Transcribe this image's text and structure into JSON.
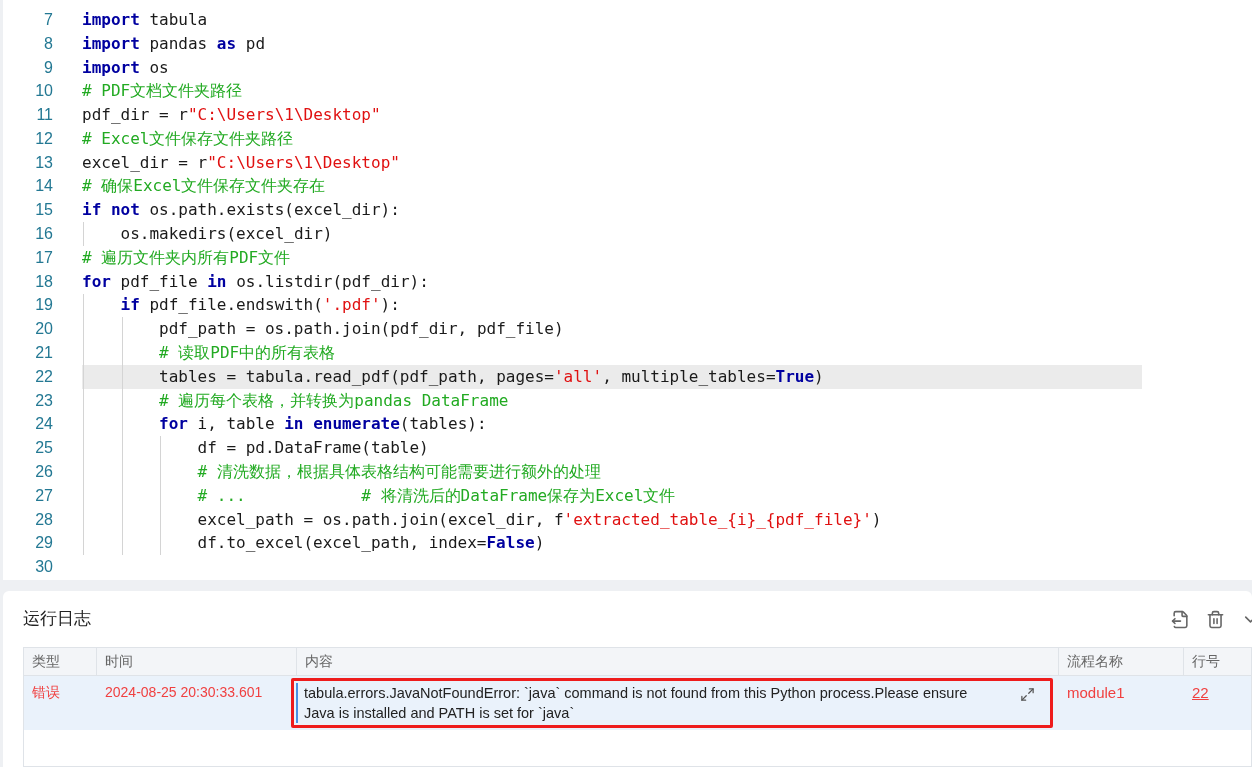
{
  "editor": {
    "lines": [
      {
        "number": "7",
        "highlighted": false,
        "tokens": [
          {
            "kind": "kw",
            "text": "import"
          },
          {
            "kind": "plain",
            "text": " tabula"
          }
        ]
      },
      {
        "number": "8",
        "highlighted": false,
        "tokens": [
          {
            "kind": "kw",
            "text": "import"
          },
          {
            "kind": "plain",
            "text": " pandas "
          },
          {
            "kind": "kw",
            "text": "as"
          },
          {
            "kind": "plain",
            "text": " pd"
          }
        ]
      },
      {
        "number": "9",
        "highlighted": false,
        "tokens": [
          {
            "kind": "kw",
            "text": "import"
          },
          {
            "kind": "plain",
            "text": " os"
          }
        ]
      },
      {
        "number": "10",
        "highlighted": false,
        "tokens": [
          {
            "kind": "comment",
            "text": "# PDF文档文件夹路径"
          }
        ]
      },
      {
        "number": "11",
        "highlighted": false,
        "tokens": [
          {
            "kind": "plain",
            "text": "pdf_dir = r"
          },
          {
            "kind": "str",
            "text": "\"C:\\Users\\1\\Desktop\""
          }
        ]
      },
      {
        "number": "12",
        "highlighted": false,
        "tokens": [
          {
            "kind": "comment",
            "text": "# Excel文件保存文件夹路径"
          }
        ]
      },
      {
        "number": "13",
        "highlighted": false,
        "tokens": [
          {
            "kind": "plain",
            "text": "excel_dir = r"
          },
          {
            "kind": "str",
            "text": "\"C:\\Users\\1\\Desktop\""
          }
        ]
      },
      {
        "number": "14",
        "highlighted": false,
        "tokens": [
          {
            "kind": "comment",
            "text": "# 确保Excel文件保存文件夹存在"
          }
        ]
      },
      {
        "number": "15",
        "highlighted": false,
        "tokens": [
          {
            "kind": "kw",
            "text": "if not"
          },
          {
            "kind": "plain",
            "text": " os.path.exists(excel_dir):"
          }
        ],
        "children": [
          {
            "number": "16",
            "highlighted": false,
            "tokens": [
              {
                "kind": "plain",
                "text": "os.makedirs(excel_dir)"
              }
            ]
          }
        ]
      },
      {
        "number": "17",
        "highlighted": false,
        "tokens": [
          {
            "kind": "comment",
            "text": "# 遍历文件夹内所有PDF文件"
          }
        ]
      },
      {
        "number": "18",
        "highlighted": false,
        "tokens": [
          {
            "kind": "kw",
            "text": "for"
          },
          {
            "kind": "plain",
            "text": " pdf_file "
          },
          {
            "kind": "kw",
            "text": "in"
          },
          {
            "kind": "plain",
            "text": " os.listdir(pdf_dir):"
          }
        ],
        "children": [
          {
            "number": "19",
            "highlighted": false,
            "tokens": [
              {
                "kind": "kw",
                "text": "if"
              },
              {
                "kind": "plain",
                "text": " pdf_file.endswith("
              },
              {
                "kind": "str",
                "text": "'.pdf'"
              },
              {
                "kind": "plain",
                "text": "):"
              }
            ],
            "children": [
              {
                "number": "20",
                "highlighted": false,
                "tokens": [
                  {
                    "kind": "plain",
                    "text": "pdf_path = os.path.join(pdf_dir, pdf_file)"
                  }
                ]
              },
              {
                "number": "21",
                "highlighted": false,
                "tokens": [
                  {
                    "kind": "comment",
                    "text": "# 读取PDF中的所有表格"
                  }
                ]
              },
              {
                "number": "22",
                "highlighted": true,
                "tokens": [
                  {
                    "kind": "plain",
                    "text": "tables = tabula.read_pdf(pdf_path, pages="
                  },
                  {
                    "kind": "str",
                    "text": "'all'"
                  },
                  {
                    "kind": "plain",
                    "text": ", multiple_tables="
                  },
                  {
                    "kind": "kw",
                    "text": "True"
                  },
                  {
                    "kind": "plain",
                    "text": ")"
                  }
                ]
              },
              {
                "number": "23",
                "highlighted": false,
                "tokens": [
                  {
                    "kind": "comment",
                    "text": "# 遍历每个表格，并转换为pandas DataFrame"
                  }
                ]
              },
              {
                "number": "24",
                "highlighted": false,
                "tokens": [
                  {
                    "kind": "kw",
                    "text": "for"
                  },
                  {
                    "kind": "plain",
                    "text": " i, table "
                  },
                  {
                    "kind": "kw",
                    "text": "in enumerate"
                  },
                  {
                    "kind": "plain",
                    "text": "(tables):"
                  }
                ],
                "children": [
                  {
                    "number": "25",
                    "highlighted": false,
                    "tokens": [
                      {
                        "kind": "plain",
                        "text": "df = pd.DataFrame(table)"
                      }
                    ]
                  },
                  {
                    "number": "26",
                    "highlighted": false,
                    "tokens": [
                      {
                        "kind": "comment",
                        "text": "# 清洗数据，根据具体表格结构可能需要进行额外的处理"
                      }
                    ]
                  },
                  {
                    "number": "27",
                    "highlighted": false,
                    "tokens": [
                      {
                        "kind": "comment",
                        "text": "# ...            # 将清洗后的DataFrame保存为Excel文件"
                      }
                    ]
                  },
                  {
                    "number": "28",
                    "highlighted": false,
                    "tokens": [
                      {
                        "kind": "plain",
                        "text": "excel_path = os.path.join(excel_dir, f"
                      },
                      {
                        "kind": "str",
                        "text": "'extracted_table_{i}_{pdf_file}'"
                      },
                      {
                        "kind": "plain",
                        "text": ")"
                      }
                    ]
                  },
                  {
                    "number": "29",
                    "highlighted": false,
                    "tokens": [
                      {
                        "kind": "plain",
                        "text": "df.to_excel(excel_path, index="
                      },
                      {
                        "kind": "kw",
                        "text": "False"
                      },
                      {
                        "kind": "plain",
                        "text": ")"
                      }
                    ]
                  }
                ]
              }
            ]
          }
        ]
      },
      {
        "number": "30",
        "highlighted": false
      }
    ]
  },
  "log": {
    "title": "运行日志",
    "table": {
      "columns": [
        "类型",
        "时间",
        "内容",
        "流程名称",
        "行号"
      ],
      "rows": [
        {
          "selected": true,
          "annotated": true,
          "type": "错误",
          "time": "2024-08-25 20:30:33.601",
          "content": "tabula.errors.JavaNotFoundError: `java` command is not found from this Python process.Please ensure Java is installed and PATH is set for `java`",
          "flow": "module1",
          "line": "22"
        }
      ]
    }
  }
}
